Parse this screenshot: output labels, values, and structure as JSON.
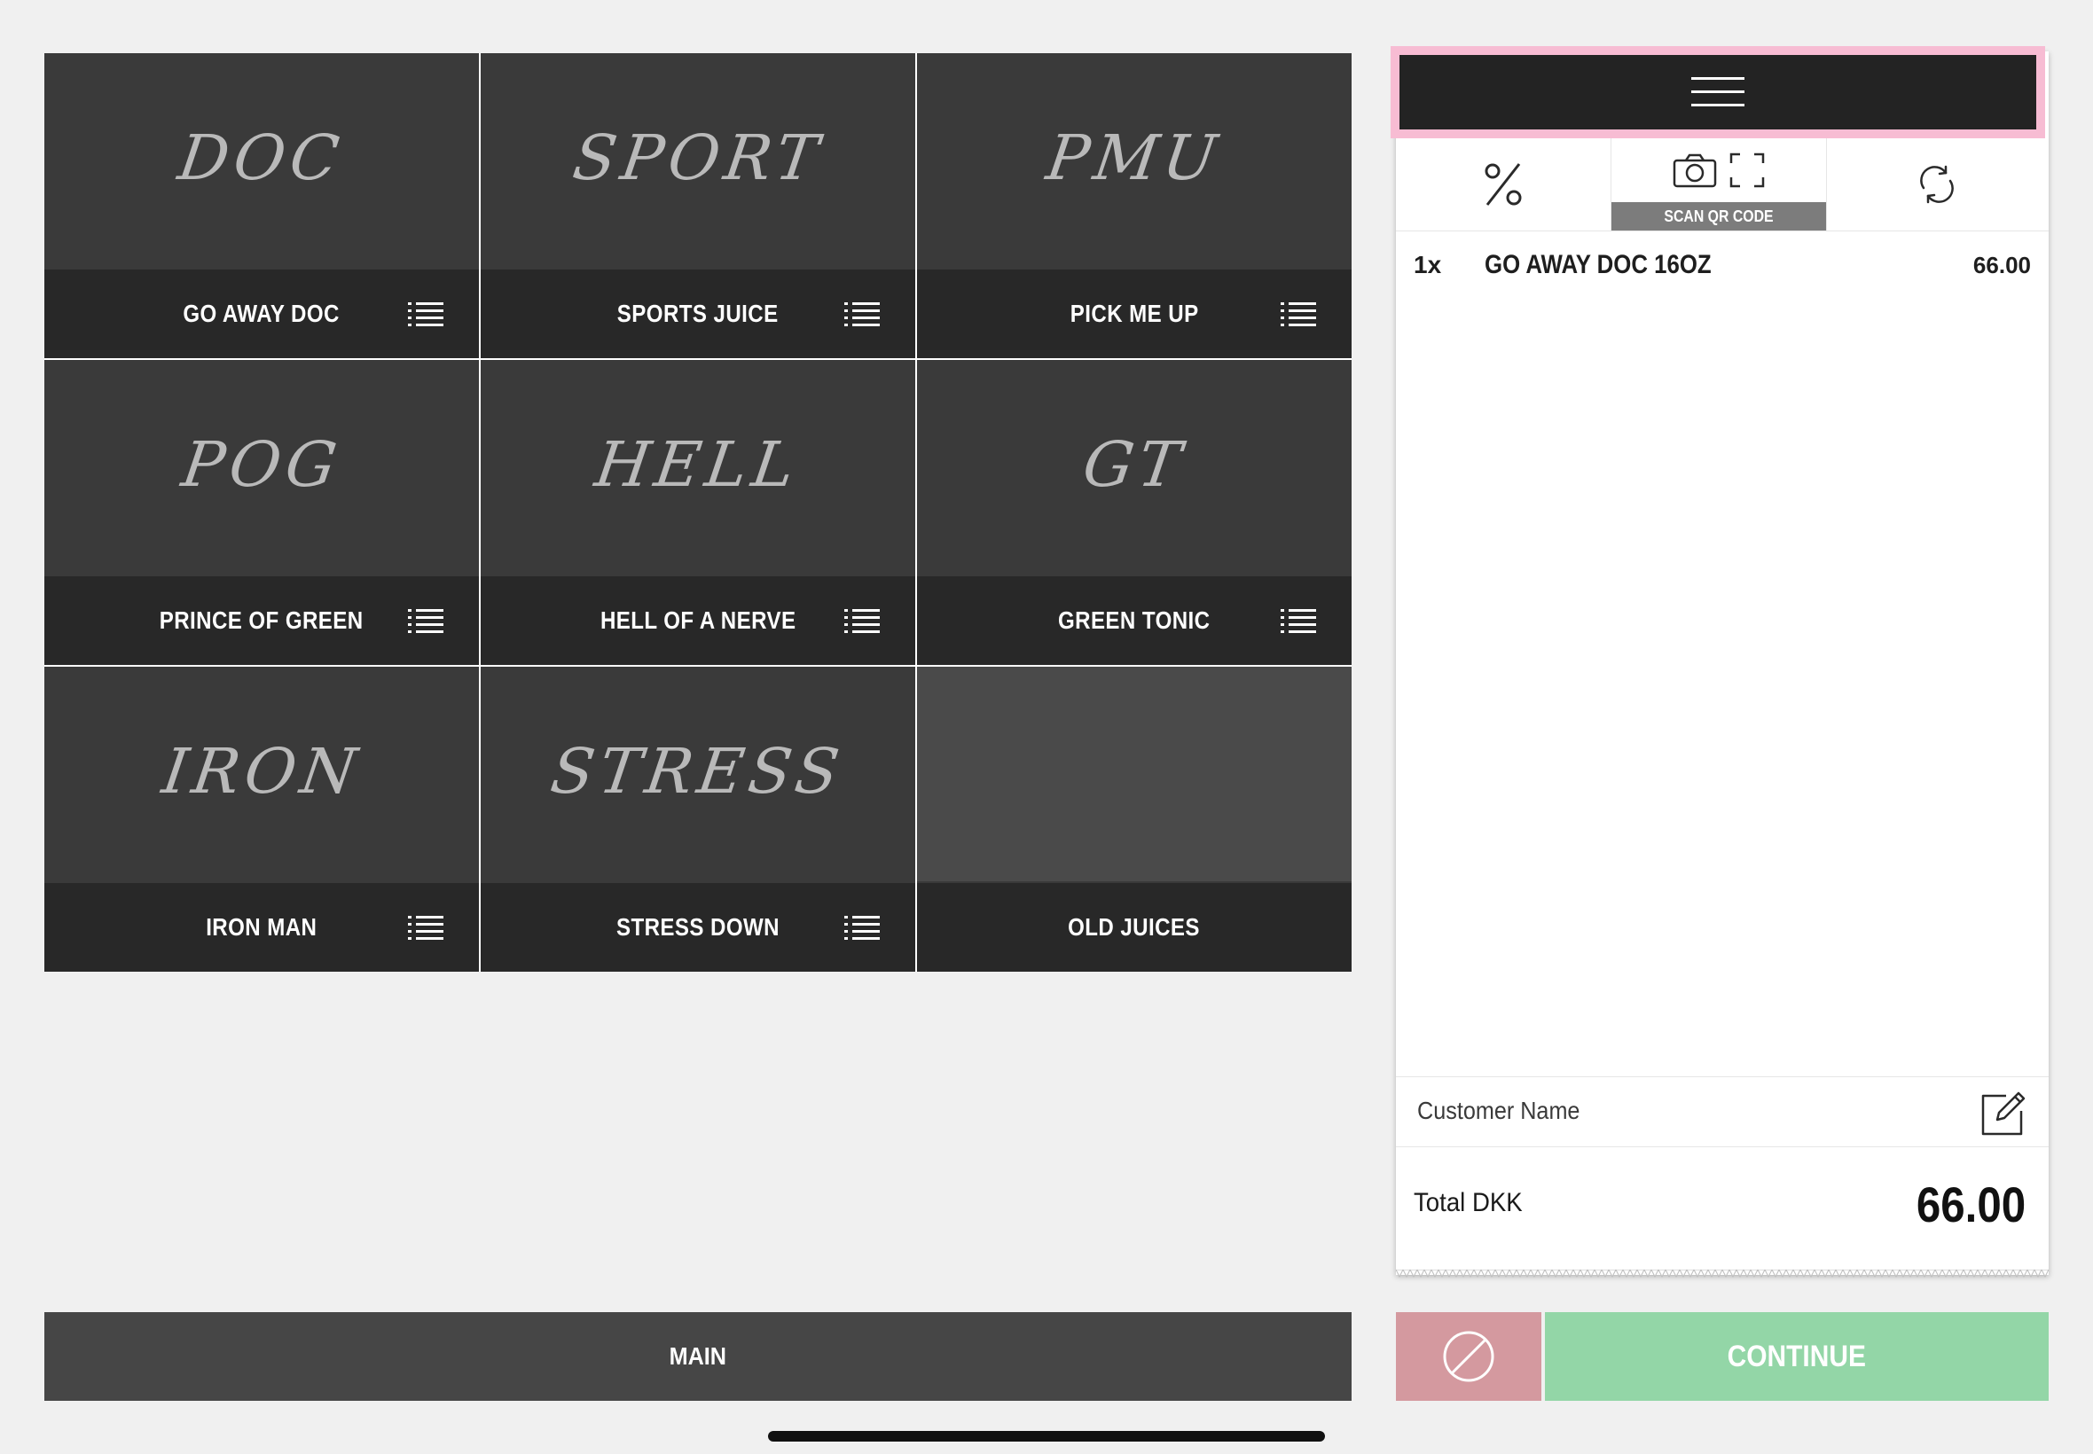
{
  "products": [
    {
      "art": "DOC",
      "label": "GO AWAY DOC",
      "has_list_icon": true
    },
    {
      "art": "SPORT",
      "label": "SPORTS JUICE",
      "has_list_icon": true
    },
    {
      "art": "PMU",
      "label": "PICK ME UP",
      "has_list_icon": true
    },
    {
      "art": "POG",
      "label": "PRINCE OF GREEN",
      "has_list_icon": true
    },
    {
      "art": "HELL",
      "label": "HELL OF A NERVE",
      "has_list_icon": true
    },
    {
      "art": "GT",
      "label": "GREEN TONIC",
      "has_list_icon": true
    },
    {
      "art": "IRON",
      "label": "IRON MAN",
      "has_list_icon": true
    },
    {
      "art": "STRESS",
      "label": "STRESS DOWN",
      "has_list_icon": true
    },
    {
      "art": "",
      "label": "OLD JUICES",
      "has_list_icon": false
    }
  ],
  "category_button": {
    "label": "MAIN"
  },
  "receipt": {
    "menu_icon": "hamburger-icon",
    "tools": {
      "discount_icon": "percent-icon",
      "scan_icons": [
        "camera-icon",
        "qr-frame-icon"
      ],
      "scan_label": "SCAN QR CODE",
      "refresh_icon": "refresh-icon"
    },
    "items": [
      {
        "qty": "1x",
        "name": "GO AWAY DOC 16OZ",
        "price": "66.00"
      }
    ],
    "customer_label": "Customer Name",
    "edit_icon": "edit-icon",
    "total_label": "Total DKK",
    "total_value": "66.00"
  },
  "actions": {
    "void_icon": "cancel-icon",
    "continue_label": "CONTINUE"
  },
  "colors": {
    "background": "#f0f0f0",
    "tile_art": "#3a3a3a",
    "tile_footer": "#282828",
    "menu_highlight": "#f7bcd3",
    "void": "#d4999f",
    "continue": "#93d6a7"
  }
}
